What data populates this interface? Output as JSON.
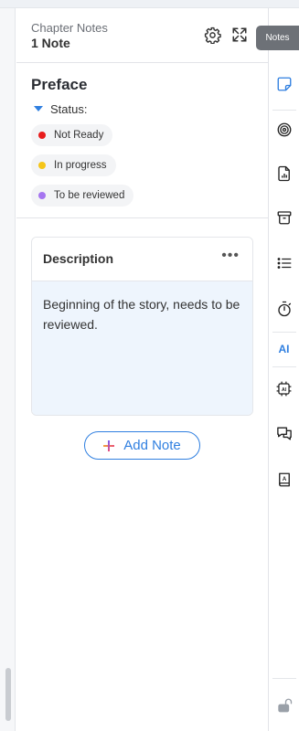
{
  "header": {
    "caption": "Chapter Notes",
    "count": "1 Note"
  },
  "tooltip": "Notes",
  "section": {
    "title": "Preface",
    "status_label": "Status:",
    "statuses": [
      {
        "label": "Not Ready",
        "color": "#e81c1c"
      },
      {
        "label": "In progress",
        "color": "#f5c518"
      },
      {
        "label": "To be reviewed",
        "color": "#a575f0"
      }
    ]
  },
  "note": {
    "title": "Description",
    "more": "•••",
    "body": "Beginning of the story, needs to be reviewed."
  },
  "add_note": {
    "label": "Add Note"
  },
  "rail": {
    "ai_label": "AI",
    "icons": [
      "sticky-note-icon",
      "target-icon",
      "document-chart-icon",
      "archive-icon",
      "list-icon",
      "stopwatch-icon",
      "ai-chip-icon",
      "chat-icon",
      "book-icon",
      "unlock-icon"
    ]
  },
  "colors": {
    "accent": "#2f7fe0",
    "note_bg": "#eef5fd"
  }
}
